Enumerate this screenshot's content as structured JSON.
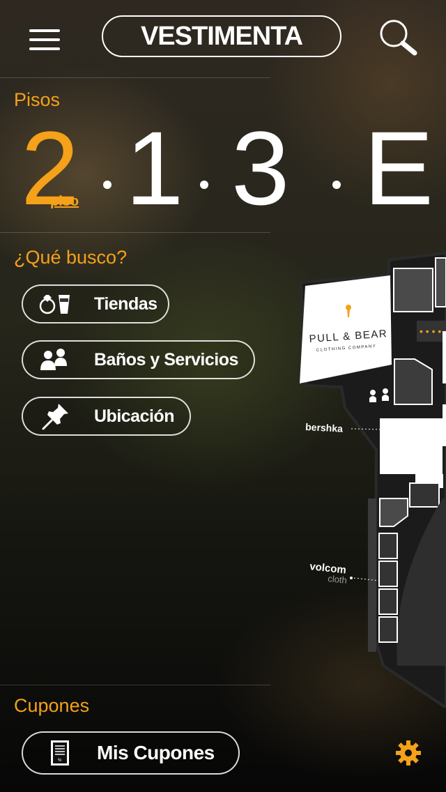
{
  "header": {
    "title": "VESTIMENTA",
    "menu_icon": "hamburger-menu-icon",
    "search_icon": "search-icon"
  },
  "floors": {
    "section_label": "Pisos",
    "active": {
      "number": "2",
      "suffix": "piso"
    },
    "others": [
      "1",
      "3",
      "E"
    ]
  },
  "search_section": {
    "label": "¿Qué busco?",
    "buttons": [
      {
        "label": "Tiendas",
        "icon": "ring-and-cup-icon"
      },
      {
        "label": "Baños y Servicios",
        "icon": "people-icon"
      },
      {
        "label": "Ubicación",
        "icon": "pushpin-icon"
      }
    ]
  },
  "map": {
    "stores": [
      {
        "name": "PULL & BEAR",
        "subtitle": "CLOTHING COMPANY"
      },
      {
        "name": "bershka"
      },
      {
        "name": "volcom",
        "subtitle": "cloth"
      }
    ]
  },
  "coupons": {
    "label": "Cupones",
    "button_label": "Mis Cupones",
    "button_icon": "coupon-document-icon"
  },
  "settings_icon": "gear-icon",
  "colors": {
    "accent": "#f5a11a",
    "text": "#ffffff"
  }
}
